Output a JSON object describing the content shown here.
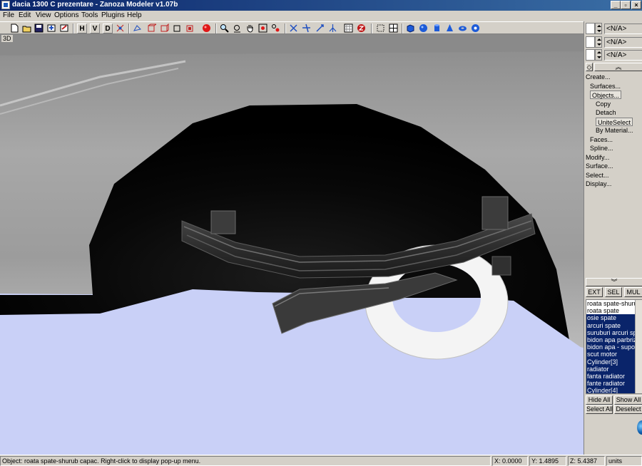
{
  "window": {
    "title": "dacia 1300 C prezentare - Zanoza Modeler v1.07b",
    "controls": [
      "_",
      "▫",
      "×"
    ]
  },
  "menu": [
    "File",
    "Edit",
    "View",
    "Options",
    "Tools",
    "Plugins",
    "Help"
  ],
  "toolbar": {
    "letters": [
      "H",
      "V",
      "D"
    ]
  },
  "viewport": {
    "label": "3D",
    "colors": {
      "floor": "#c9d0f7",
      "wall": "#9a9a9a",
      "arch": "#050505",
      "tire": "#f4f4f4"
    }
  },
  "right_panel": {
    "spinners": [
      {
        "value": "<N/A>"
      },
      {
        "value": "<N/A>"
      },
      {
        "value": "<N/A>"
      }
    ],
    "tree": [
      {
        "label": "Create...",
        "level": 0
      },
      {
        "label": "Surfaces...",
        "level": 1
      },
      {
        "label": "Objects...",
        "level": 1,
        "boxed": true
      },
      {
        "label": "Copy",
        "level": 2
      },
      {
        "label": "Detach",
        "level": 2
      },
      {
        "label": "UniteSelect",
        "level": 2,
        "boxed": true
      },
      {
        "label": "By Material...",
        "level": 2
      },
      {
        "label": "Faces...",
        "level": 1
      },
      {
        "label": "Spline...",
        "level": 1
      },
      {
        "label": "Modify...",
        "level": 0
      },
      {
        "label": "Surface...",
        "level": 0
      },
      {
        "label": "Select...",
        "level": 0
      },
      {
        "label": "Display...",
        "level": 0
      }
    ],
    "mode_buttons": [
      "EXT",
      "SEL",
      "MUL"
    ],
    "objects": [
      {
        "name": "roata spate-shurub",
        "selected": false
      },
      {
        "name": "roata spate",
        "selected": false
      },
      {
        "name": "osie spate",
        "selected": true
      },
      {
        "name": "arcuri spate",
        "selected": true
      },
      {
        "name": "suruburi arcuri spate",
        "selected": true
      },
      {
        "name": "bidon apa parbriz",
        "selected": true
      },
      {
        "name": "bidon apa - suport",
        "selected": true
      },
      {
        "name": "scut motor",
        "selected": true
      },
      {
        "name": "Cylinder[3]",
        "selected": true
      },
      {
        "name": "radiator",
        "selected": true
      },
      {
        "name": "fanta radiator",
        "selected": true
      },
      {
        "name": "fante radiator",
        "selected": true
      },
      {
        "name": "Cylinder[4]",
        "selected": true
      }
    ],
    "buttons": {
      "hide_all": "Hide All",
      "show_all": "Show All",
      "select_all": "Select All",
      "deselect": "Deselect"
    }
  },
  "status": {
    "message": "Object: roata spate-shurub capac. Right-click to display pop-up menu.",
    "x": "X: 0.0000",
    "y": "Y: 1.4895",
    "z": "Z: 5.4387",
    "units": "units"
  }
}
